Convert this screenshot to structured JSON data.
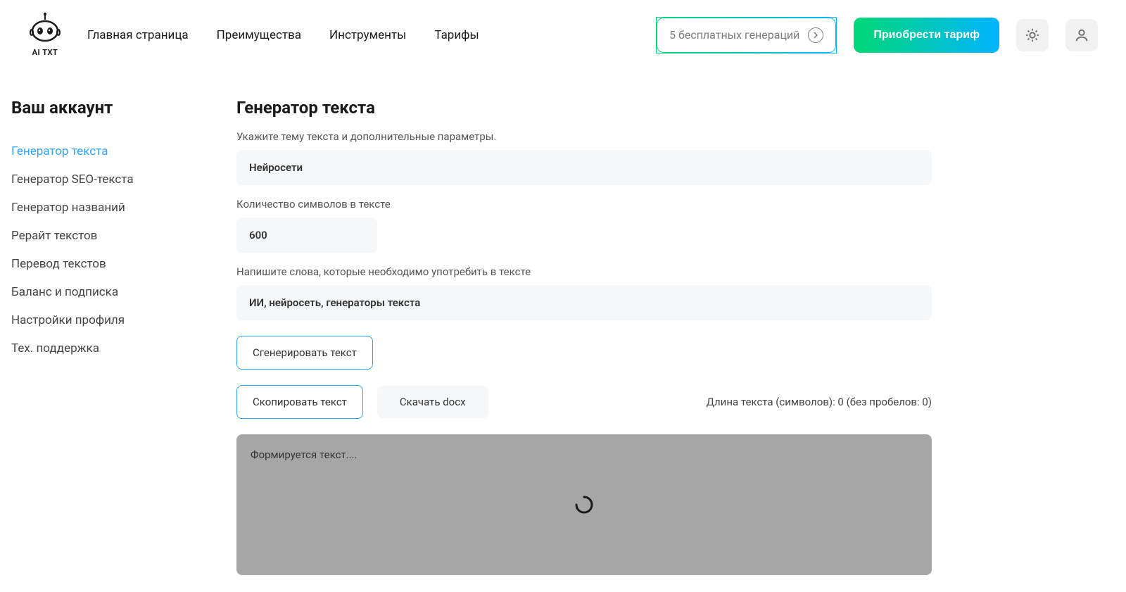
{
  "header": {
    "logo_text": "AI TXT",
    "nav": [
      "Главная страница",
      "Преимущества",
      "Инструменты",
      "Тарифы"
    ],
    "free_gen_label": "5 бесплатных генераций",
    "buy_label": "Приобрести тариф"
  },
  "sidebar": {
    "title": "Ваш аккаунт",
    "items": [
      {
        "label": "Генератор текста",
        "active": true
      },
      {
        "label": "Генератор SEO-текста",
        "active": false
      },
      {
        "label": "Генератор названий",
        "active": false
      },
      {
        "label": "Рерайт текстов",
        "active": false
      },
      {
        "label": "Перевод текстов",
        "active": false
      },
      {
        "label": "Баланс и подписка",
        "active": false
      },
      {
        "label": "Настройки профиля",
        "active": false
      },
      {
        "label": "Тех. поддержка",
        "active": false
      }
    ]
  },
  "content": {
    "title": "Генератор текста",
    "label_topic": "Укажите тему текста и дополнительные параметры.",
    "value_topic": "Нейросети",
    "label_chars": "Количество символов в тексте",
    "value_chars": "600",
    "label_words": "Напишите слова, которые необходимо употребить в тексте",
    "value_words": "ИИ, нейросеть, генераторы текста",
    "btn_generate": "Сгенерировать текст",
    "btn_copy": "Скопировать текст",
    "btn_download": "Скачать docx",
    "length_text": "Длина текста (символов): 0 (без пробелов: 0)",
    "output_placeholder": "Формируется текст...."
  }
}
